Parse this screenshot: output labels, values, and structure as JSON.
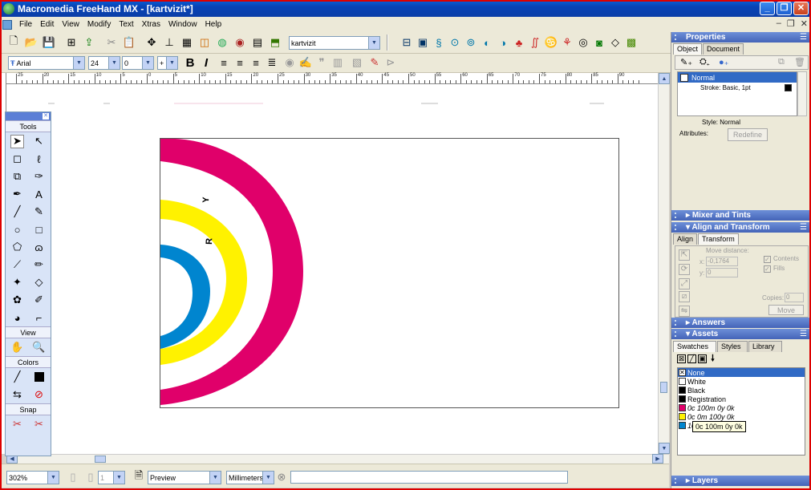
{
  "app": {
    "title": "Macromedia FreeHand MX - [kartvizit*]"
  },
  "menubar": {
    "items": [
      "File",
      "Edit",
      "View",
      "Modify",
      "Text",
      "Xtras",
      "Window",
      "Help"
    ]
  },
  "toolbar": {
    "document_combo": "kartvizit",
    "font_combo": "Arial",
    "size_combo": "24",
    "leading_combo": "0"
  },
  "ruler": {
    "labels": [
      "25",
      "20",
      "15",
      "10",
      "5",
      "0",
      "5",
      "10",
      "15",
      "20",
      "25",
      "30",
      "35",
      "40",
      "45",
      "50",
      "55",
      "60",
      "65",
      "70",
      "75",
      "80",
      "85",
      "90"
    ]
  },
  "tools": {
    "header": "Tools",
    "view_header": "View",
    "colors_header": "Colors",
    "snap_header": "Snap"
  },
  "statusbar": {
    "zoom": "302%",
    "page": "1",
    "render_mode": "Preview",
    "units": "Millimeters"
  },
  "properties": {
    "title": "Properties",
    "tabs": [
      "Object",
      "Document"
    ],
    "list_item": "Normal",
    "stroke_item": "Stroke: Basic, 1pt",
    "style_label": "Style: Normal",
    "attributes_label": "Attributes:",
    "redefine_button": "Redefine"
  },
  "panels": {
    "mixer": "Mixer and Tints",
    "align": "Align and Transform",
    "answers": "Answers",
    "assets": "Assets",
    "layers": "Layers"
  },
  "align_transform": {
    "tabs": [
      "Align",
      "Transform"
    ],
    "move_distance": "Move distance:",
    "x_label": "x:",
    "x_value": "-0,1764",
    "y_label": "y:",
    "y_value": "0",
    "contents_label": "Contents",
    "fills_label": "Fills",
    "copies_label": "Copies:",
    "copies_value": "0",
    "move_button": "Move"
  },
  "assets": {
    "tabs": [
      "Swatches",
      "Styles",
      "Library"
    ],
    "swatches": [
      {
        "label": "None",
        "color": "#ffffff",
        "selected": true
      },
      {
        "label": "White",
        "color": "#ffffff",
        "selected": false
      },
      {
        "label": "Black",
        "color": "#000000",
        "selected": false
      },
      {
        "label": "Registration",
        "color": "#000000",
        "selected": false
      },
      {
        "label": "0c 100m 0y 0k",
        "color": "#e0006a",
        "selected": false
      },
      {
        "label": "0c 0m 100y 0k",
        "color": "#fff200",
        "selected": false
      },
      {
        "label": "100c 0m 0y 0k",
        "color": "#0085cf",
        "selected": false
      }
    ],
    "tooltip": "0c 100m 0y 0k"
  },
  "colors": {
    "magenta": "#e0006a",
    "yellow": "#fff200",
    "cyan": "#0085cf"
  }
}
